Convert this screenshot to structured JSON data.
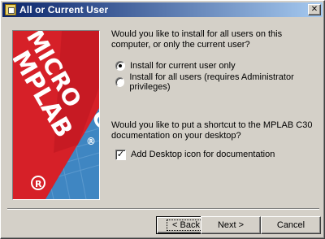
{
  "window": {
    "title": "All or Current User",
    "close_glyph": "✕"
  },
  "logo": {
    "line1": "MICRO",
    "line2": "MPLAB",
    "trademark": "®",
    "fragment": "C"
  },
  "install_question": "Would you like to install for all users on this computer, or only the current user?",
  "install_options": [
    {
      "label": "Install for current user only",
      "selected": true
    },
    {
      "label": "Install for all users (requires Administrator privileges)",
      "selected": false
    }
  ],
  "shortcut_question": "Would you like to put a shortcut to the MPLAB C30 documentation on your desktop?",
  "shortcut_option": {
    "label": "Add Desktop icon for documentation",
    "checked": true,
    "check_glyph": "✓"
  },
  "buttons": {
    "back": "< Back",
    "next": "Next >",
    "cancel": "Cancel"
  },
  "colors": {
    "titlebar_start": "#0a246a",
    "titlebar_end": "#a6caf0",
    "dialog_bg": "#d4d0c8",
    "logo_red": "#d62028",
    "logo_blue": "#3f86c2"
  },
  "icons": {
    "title": "installer-icon",
    "close": "close-icon"
  }
}
